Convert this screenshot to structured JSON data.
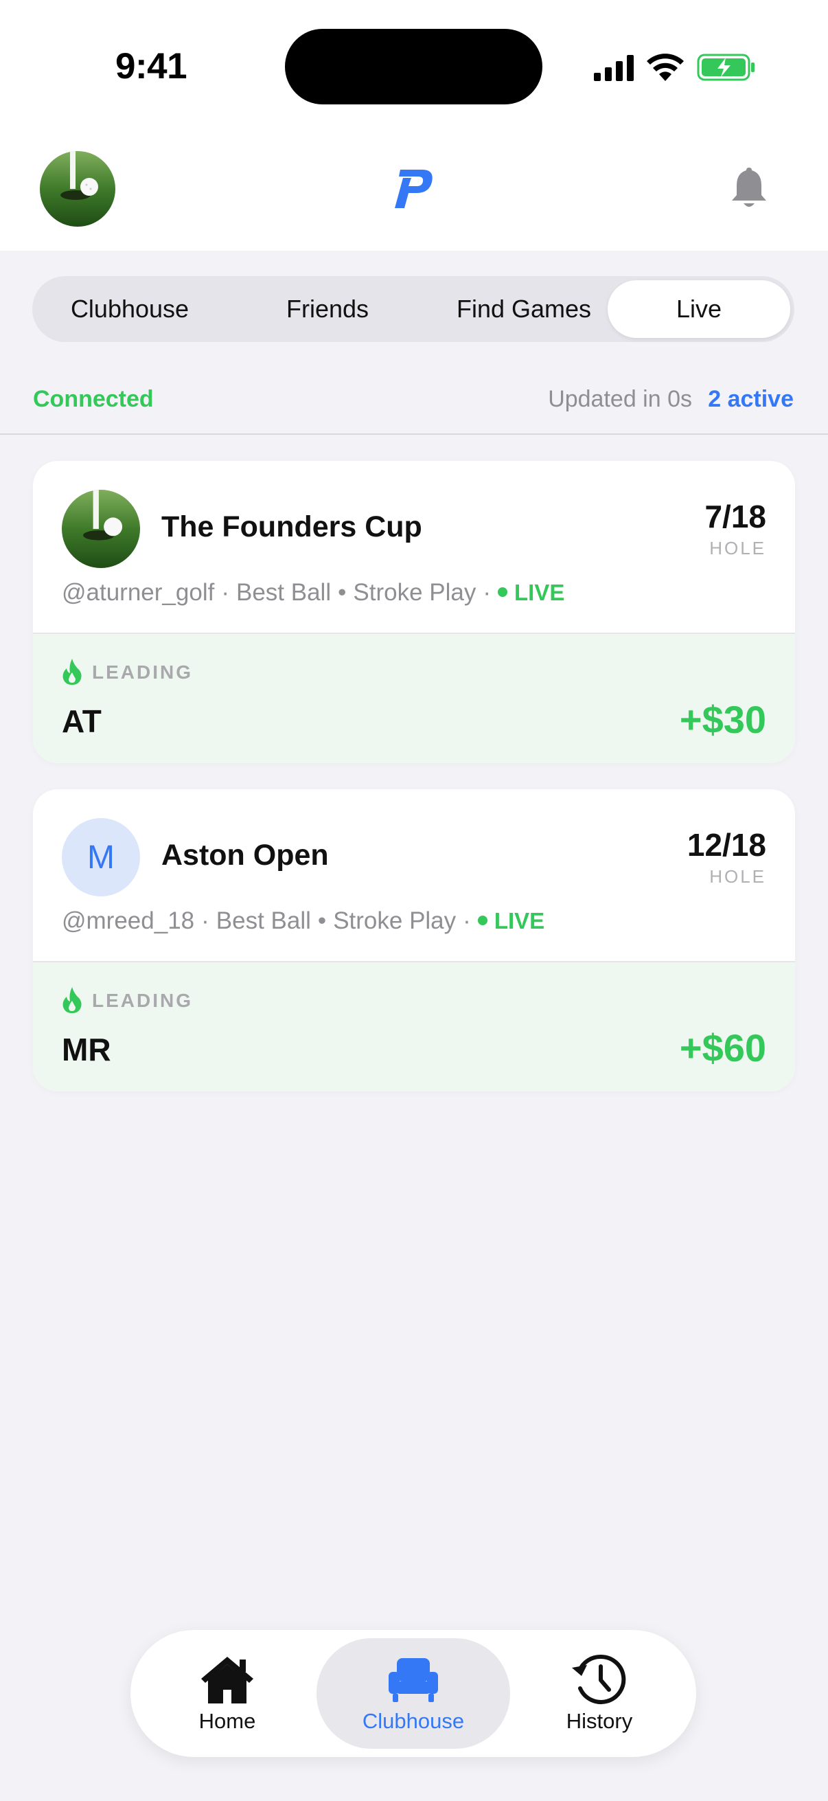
{
  "status_bar": {
    "time": "9:41"
  },
  "header": {
    "avatar_icon": "golf-ball-photo",
    "logo_icon": "app-logo-p",
    "bell_icon": "bell-icon"
  },
  "tabs": [
    {
      "label": "Clubhouse",
      "active": false
    },
    {
      "label": "Friends",
      "active": false
    },
    {
      "label": "Find Games",
      "active": false
    },
    {
      "label": "Live",
      "active": true
    }
  ],
  "connection": {
    "status": "Connected",
    "updated": "Updated in 0s",
    "active_count": "2 active"
  },
  "games": [
    {
      "avatar": "golf-photo",
      "title": "The Founders Cup",
      "hole": "7/18",
      "hole_label": "HOLE",
      "host": "@aturner_golf",
      "format": "Best Ball",
      "scoring": "Stroke Play",
      "live_label": "LIVE",
      "leading_label": "LEADING",
      "leader": "AT",
      "amount": "+$30"
    },
    {
      "avatar_initial": "M",
      "title": "Aston Open",
      "hole": "12/18",
      "hole_label": "HOLE",
      "host": "@mreed_18",
      "format": "Best Ball",
      "scoring": "Stroke Play",
      "live_label": "LIVE",
      "leading_label": "LEADING",
      "leader": "MR",
      "amount": "+$60"
    }
  ],
  "nav": [
    {
      "label": "Home",
      "icon": "home-icon",
      "active": false
    },
    {
      "label": "Clubhouse",
      "icon": "armchair-icon",
      "active": true
    },
    {
      "label": "History",
      "icon": "history-icon",
      "active": false
    }
  ],
  "colors": {
    "accent": "#3478f6",
    "live_green": "#34c759",
    "background": "#f2f2f7"
  }
}
